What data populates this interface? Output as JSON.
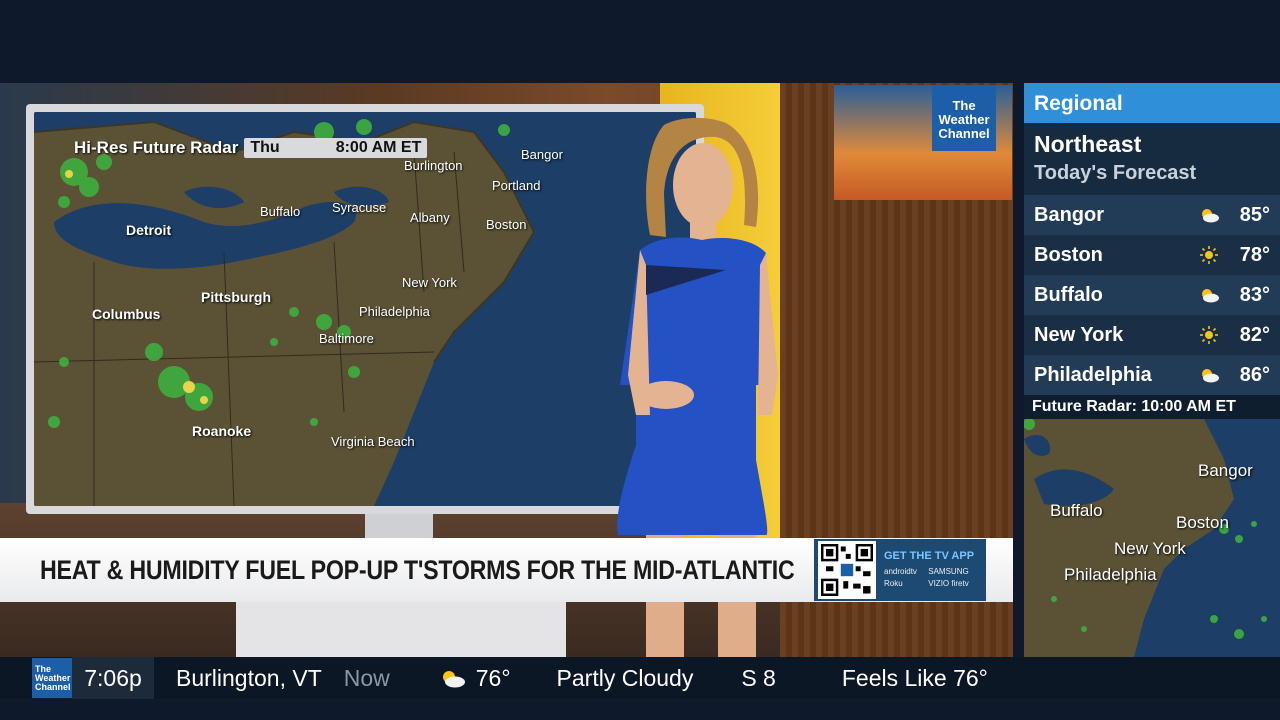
{
  "radar": {
    "title": "Hi-Res Future Radar",
    "day": "Thu",
    "time": "8:00 AM ET",
    "cities": [
      "Burlington",
      "Bangor",
      "Portland",
      "Detroit",
      "Buffalo",
      "Syracuse",
      "Albany",
      "Boston",
      "New York",
      "Pittsburgh",
      "Columbus",
      "Philadelphia",
      "Baltimore",
      "Roanoke",
      "Virginia Beach"
    ]
  },
  "headline": "HEAT & HUMIDITY FUEL POP-UP T'STORMS FOR THE MID-ATLANTIC",
  "app_promo": {
    "cta": "GET THE TV APP",
    "brands": [
      "androidtv",
      "SAMSUNG",
      "Roku",
      "VIZIO",
      "firetv"
    ]
  },
  "logo_text": "The Weather Channel",
  "sidebar": {
    "header": "Regional",
    "region": "Northeast",
    "subtitle": "Today's Forecast",
    "forecast": [
      {
        "city": "Bangor",
        "icon": "partly-cloudy-icon",
        "temp": "85°"
      },
      {
        "city": "Boston",
        "icon": "sunny-icon",
        "temp": "78°"
      },
      {
        "city": "Buffalo",
        "icon": "partly-cloudy-icon",
        "temp": "83°"
      },
      {
        "city": "New York",
        "icon": "sunny-icon",
        "temp": "82°"
      },
      {
        "city": "Philadelphia",
        "icon": "partly-cloudy-icon",
        "temp": "86°"
      }
    ],
    "future_radar_label": "Future Radar: 10:00 AM ET",
    "map_cities": [
      "Bangor",
      "Buffalo",
      "Boston",
      "New York",
      "Philadelphia"
    ]
  },
  "ticker": {
    "time": "7:06p",
    "location": "Burlington, VT",
    "now_label": "Now",
    "temp": "76°",
    "condition": "Partly Cloudy",
    "wind": "S 8",
    "feels_like": "Feels Like 76°"
  },
  "colors": {
    "accent_blue": "#2f8fd8",
    "brand_blue": "#1c5ea8",
    "sidebar_bg": "#172b40",
    "headline_bg": "#ffffff"
  }
}
